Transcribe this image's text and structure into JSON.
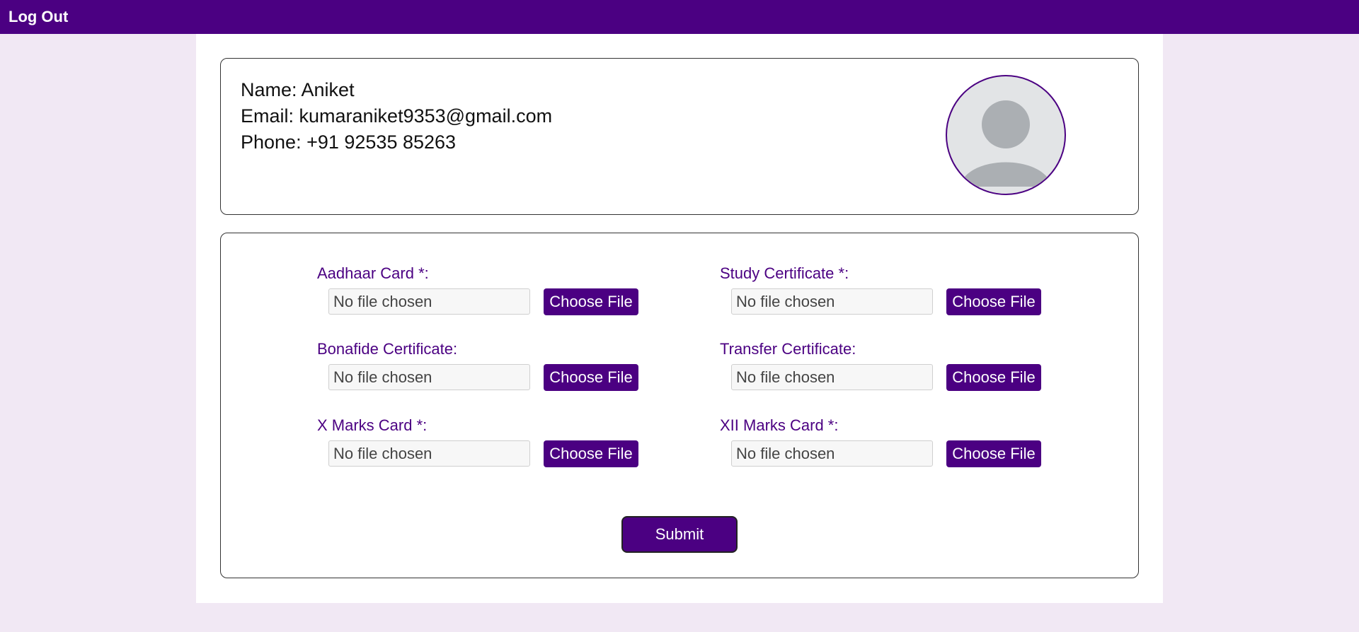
{
  "header": {
    "logout_label": "Log Out"
  },
  "profile": {
    "name_line": "Name: Aniket",
    "email_line": "Email: kumaraniket9353@gmail.com",
    "phone_line": "Phone: +91 92535 85263",
    "avatar_icon": "user-avatar-icon"
  },
  "uploads": {
    "fields": [
      {
        "label": "Aadhaar Card *:",
        "status": "No file chosen",
        "button": "Choose File"
      },
      {
        "label": "Study Certificate *:",
        "status": "No file chosen",
        "button": "Choose File"
      },
      {
        "label": "Bonafide Certificate:",
        "status": "No file chosen",
        "button": "Choose File"
      },
      {
        "label": "Transfer Certificate:",
        "status": "No file chosen",
        "button": "Choose File"
      },
      {
        "label": "X Marks Card *:",
        "status": "No file chosen",
        "button": "Choose File"
      },
      {
        "label": "XII Marks Card *:",
        "status": "No file chosen",
        "button": "Choose File"
      }
    ],
    "submit_label": "Submit"
  },
  "colors": {
    "primary": "#4b0082",
    "page_background": "#f1e8f4",
    "card_background": "#ffffff"
  }
}
